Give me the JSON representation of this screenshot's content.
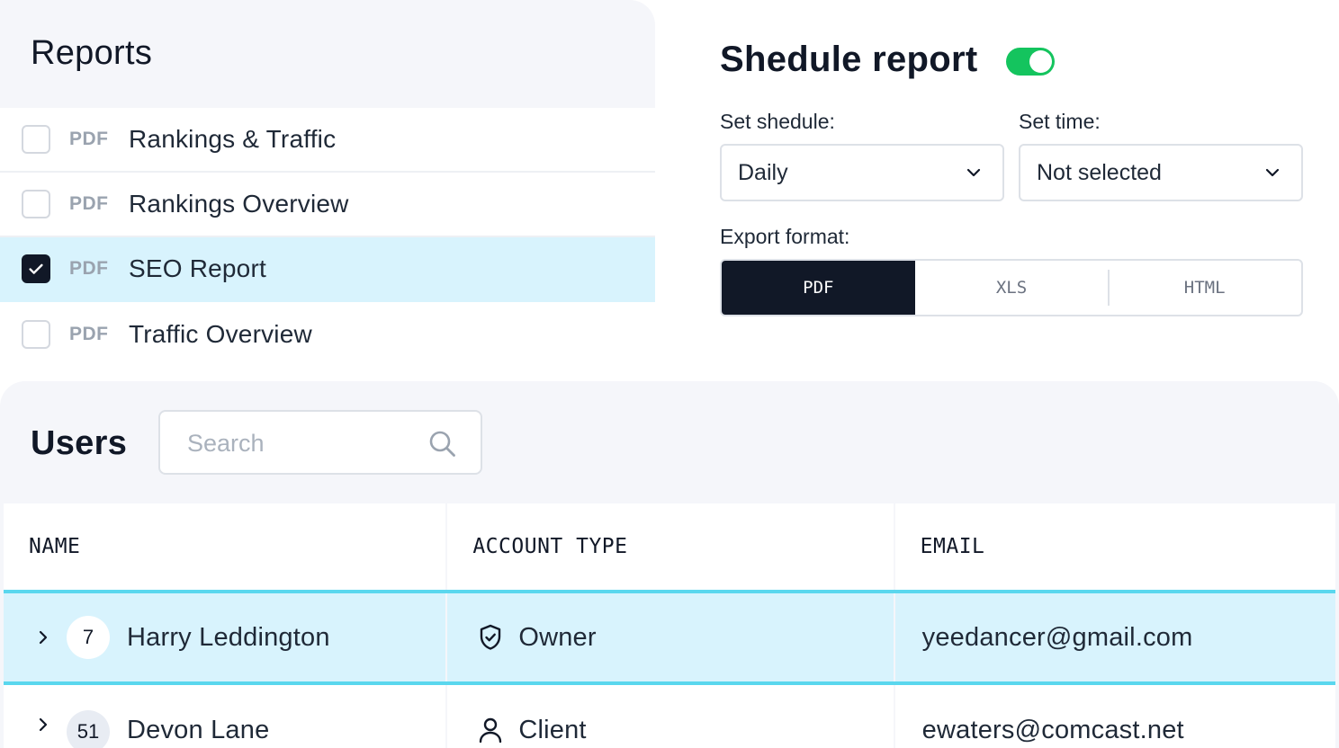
{
  "reports": {
    "title": "Reports",
    "items": [
      {
        "format": "PDF",
        "name": "Rankings & Traffic",
        "checked": false
      },
      {
        "format": "PDF",
        "name": "Rankings Overview",
        "checked": false
      },
      {
        "format": "PDF",
        "name": "SEO Report",
        "checked": true
      },
      {
        "format": "PDF",
        "name": "Traffic Overview",
        "checked": false
      }
    ]
  },
  "schedule": {
    "title": "Shedule report",
    "enabled": true,
    "schedule_label": "Set shedule:",
    "schedule_value": "Daily",
    "time_label": "Set time:",
    "time_value": "Not selected",
    "format_label": "Export format:",
    "formats": [
      "PDF",
      "XLS",
      "HTML"
    ],
    "selected_format": "PDF"
  },
  "users": {
    "title": "Users",
    "search_placeholder": "Search",
    "columns": [
      "NAME",
      "ACCOUNT TYPE",
      "EMAIL"
    ],
    "rows": [
      {
        "count": "7",
        "name": "Harry Leddington",
        "account_type": "Owner",
        "account_icon": "shield-icon",
        "email": "yeedancer@gmail.com"
      },
      {
        "count": "51",
        "name": "Devon Lane",
        "account_type": "Client",
        "account_icon": "user-icon",
        "email": "ewaters@comcast.net"
      }
    ]
  },
  "colors": {
    "accent": "#14c45e",
    "selected_row": "#d8f3fd",
    "row_border": "#5ad7ee",
    "dark": "#111827",
    "panel_bg": "#f5f6fa"
  }
}
